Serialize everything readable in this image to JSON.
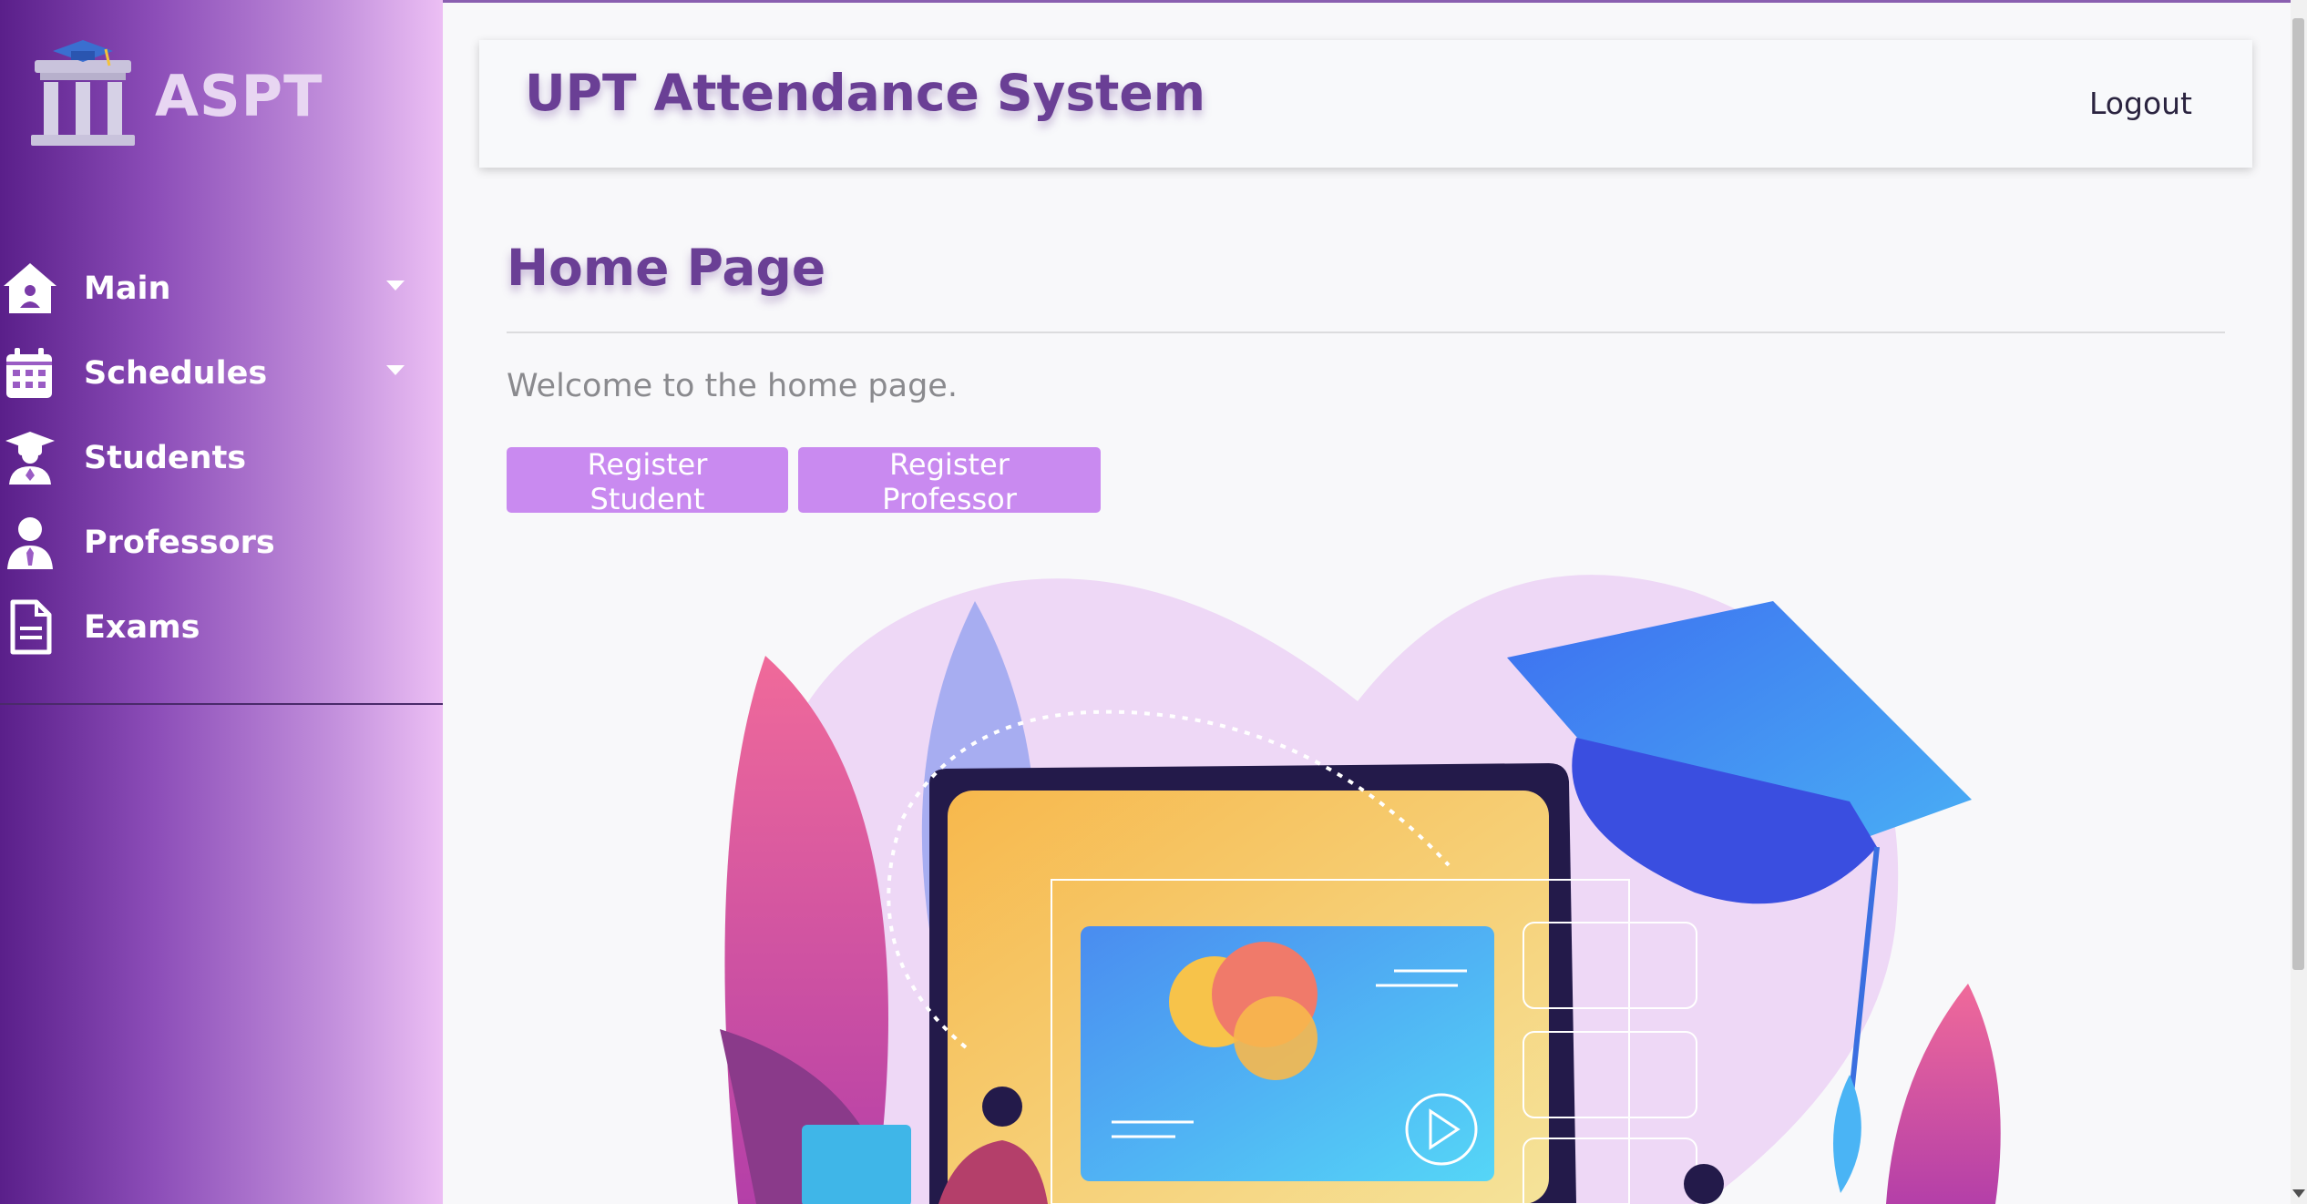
{
  "brand": {
    "name": "ASPT"
  },
  "sidebar": {
    "items": [
      {
        "label": "Main",
        "icon": "home-icon",
        "has_submenu": true
      },
      {
        "label": "Schedules",
        "icon": "calendar-icon",
        "has_submenu": true
      },
      {
        "label": "Students",
        "icon": "graduate-icon",
        "has_submenu": false
      },
      {
        "label": "Professors",
        "icon": "user-tie-icon",
        "has_submenu": false
      },
      {
        "label": "Exams",
        "icon": "document-icon",
        "has_submenu": false
      }
    ]
  },
  "header": {
    "title": "UPT Attendance System",
    "logout_label": "Logout"
  },
  "main": {
    "page_title": "Home Page",
    "welcome_text": "Welcome to the home page.",
    "buttons": {
      "register_student": "Register Student",
      "register_professor": "Register Professor"
    }
  },
  "colors": {
    "sidebar_gradient_start": "#5a1f8a",
    "sidebar_gradient_end": "#ecbff4",
    "title_purple": "#6a3f95",
    "button_purple": "#c98af0",
    "background": "#f8f8fa"
  }
}
